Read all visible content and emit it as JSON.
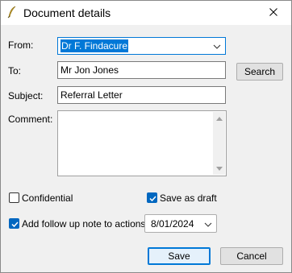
{
  "window": {
    "title": "Document details",
    "app_icon": "quill-icon",
    "close_icon": "close-icon"
  },
  "form": {
    "from_label": "From:",
    "from_value": "Dr F. Findacure",
    "to_label": "To:",
    "to_value": "Mr Jon Jones",
    "search_label": "Search",
    "subject_label": "Subject:",
    "subject_value": "Referral Letter",
    "comment_label": "Comment:",
    "comment_value": "",
    "confidential_label": "Confidential",
    "confidential_checked": false,
    "save_as_draft_label": "Save as draft",
    "save_as_draft_checked": true,
    "follow_up_label": "Add follow up note to actions",
    "follow_up_checked": true,
    "follow_up_date": "8/01/2024"
  },
  "buttons": {
    "save_label": "Save",
    "cancel_label": "Cancel"
  },
  "colors": {
    "accent": "#0078d7",
    "checkbox_fill": "#0067c0"
  }
}
